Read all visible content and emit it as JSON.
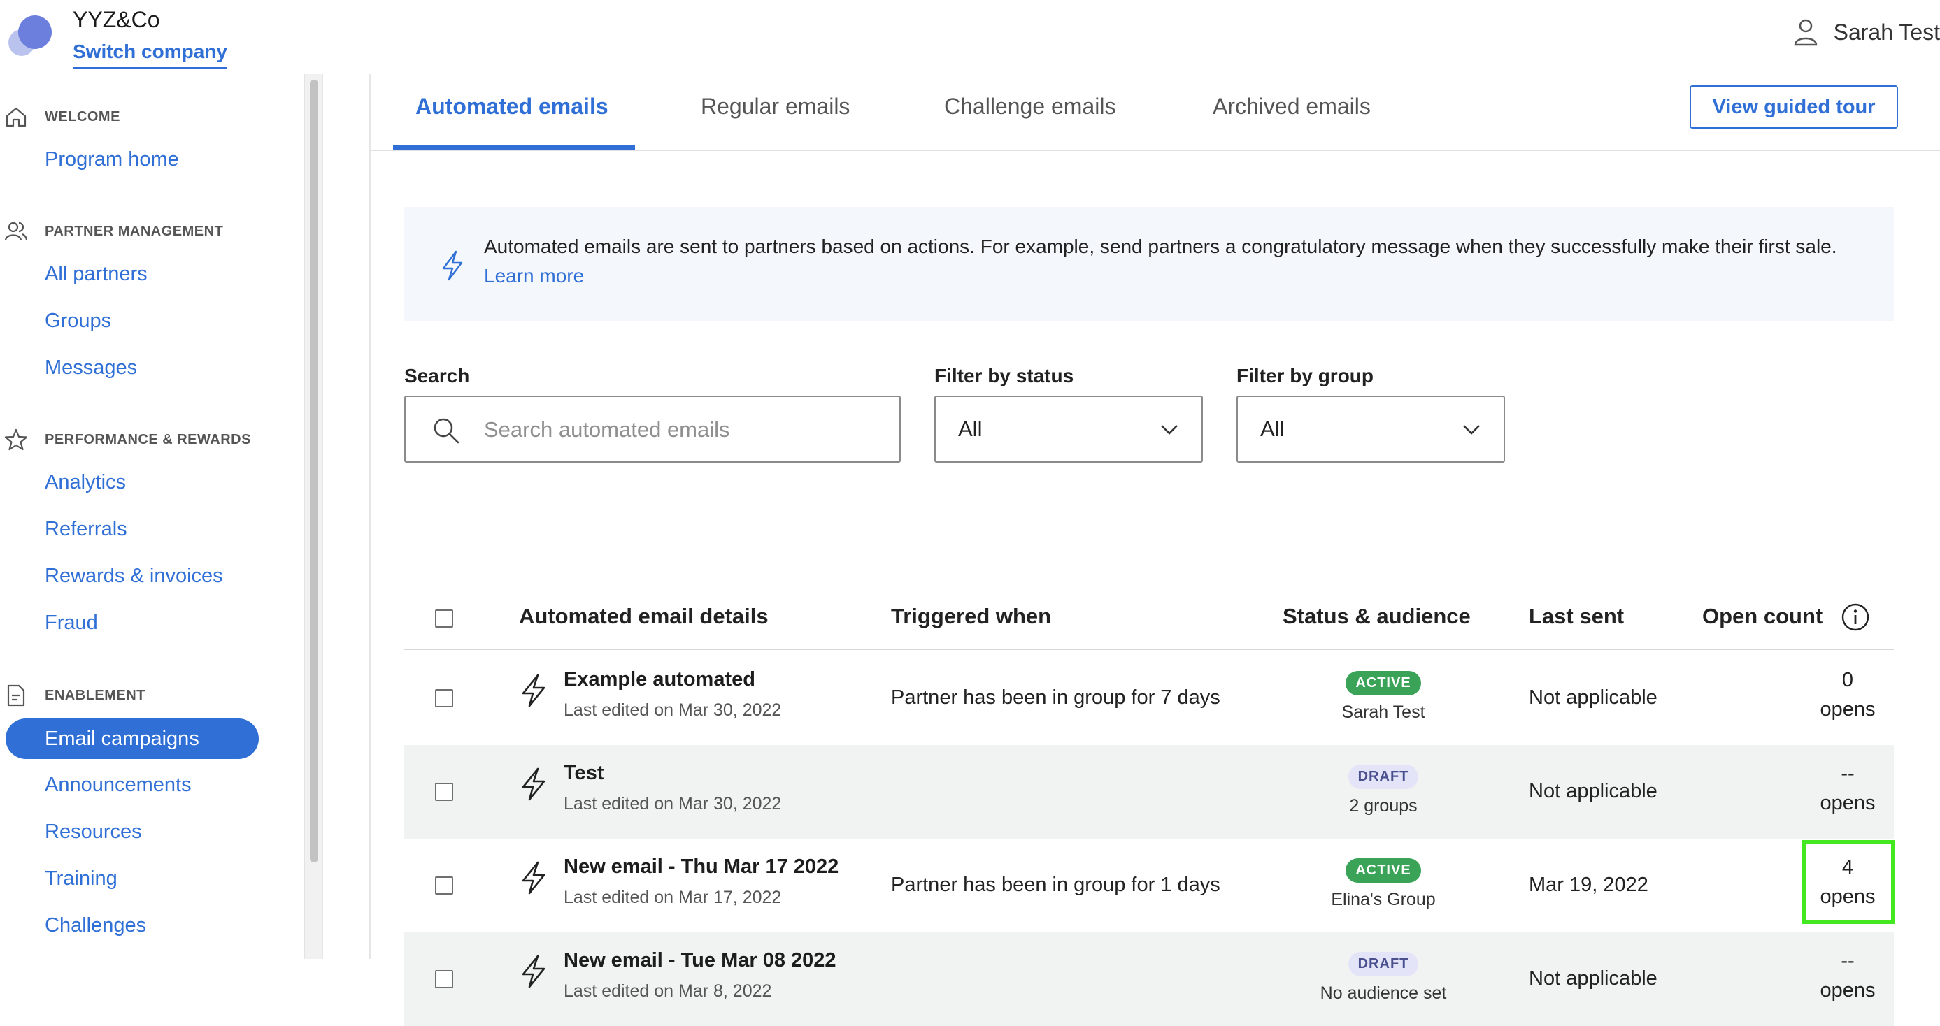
{
  "header": {
    "company_name": "YYZ&Co",
    "switch_company": "Switch company",
    "user_name": "Sarah Test"
  },
  "sidebar": {
    "sections": [
      {
        "label": "WELCOME",
        "icon": "home-icon",
        "items": [
          "Program home"
        ]
      },
      {
        "label": "PARTNER MANAGEMENT",
        "icon": "users-icon",
        "items": [
          "All partners",
          "Groups",
          "Messages"
        ]
      },
      {
        "label": "PERFORMANCE & REWARDS",
        "icon": "star-icon",
        "items": [
          "Analytics",
          "Referrals",
          "Rewards & invoices",
          "Fraud"
        ]
      },
      {
        "label": "ENABLEMENT",
        "icon": "document-icon",
        "items": [
          "Email campaigns",
          "Announcements",
          "Resources",
          "Training",
          "Challenges"
        ]
      }
    ],
    "active_item": "Email campaigns"
  },
  "tabs": [
    "Automated emails",
    "Regular emails",
    "Challenge emails",
    "Archived emails"
  ],
  "active_tab": "Automated emails",
  "guided_tour_button": "View guided tour",
  "info": {
    "text": "Automated emails are sent to partners based on actions. For example, send partners a congratulatory message when they successfully make their first sale.",
    "link": "Learn more"
  },
  "filters": {
    "search_label": "Search",
    "search_placeholder": "Search automated emails",
    "status_label": "Filter by status",
    "status_value": "All",
    "group_label": "Filter by group",
    "group_value": "All"
  },
  "table": {
    "columns": [
      "Automated email details",
      "Triggered when",
      "Status & audience",
      "Last sent",
      "Open count"
    ],
    "rows": [
      {
        "title": "Example automated",
        "edited": "Last edited on Mar 30, 2022",
        "trigger": "Partner has been in group for 7 days",
        "status": "ACTIVE",
        "audience": "Sarah Test",
        "last_sent": "Not applicable",
        "open_count": "0",
        "open_unit": "opens"
      },
      {
        "title": "Test",
        "edited": "Last edited on Mar 30, 2022",
        "trigger": "",
        "status": "DRAFT",
        "audience": "2 groups",
        "last_sent": "Not applicable",
        "open_count": "--",
        "open_unit": "opens"
      },
      {
        "title": "New email - Thu Mar 17 2022",
        "edited": "Last edited on Mar 17, 2022",
        "trigger": "Partner has been in group for 1 days",
        "status": "ACTIVE",
        "audience": "Elina's Group",
        "last_sent": "Mar 19, 2022",
        "open_count": "4",
        "open_unit": "opens"
      },
      {
        "title": "New email - Tue Mar 08 2022",
        "edited": "Last edited on Mar 8, 2022",
        "trigger": "",
        "status": "DRAFT",
        "audience": "No audience set",
        "last_sent": "Not applicable",
        "open_count": "--",
        "open_unit": "opens"
      }
    ]
  },
  "colors": {
    "accent": "#2f6fd6",
    "active_badge": "#3aa357",
    "draft_badge": "#e3e4f8",
    "highlight": "#44e820"
  }
}
